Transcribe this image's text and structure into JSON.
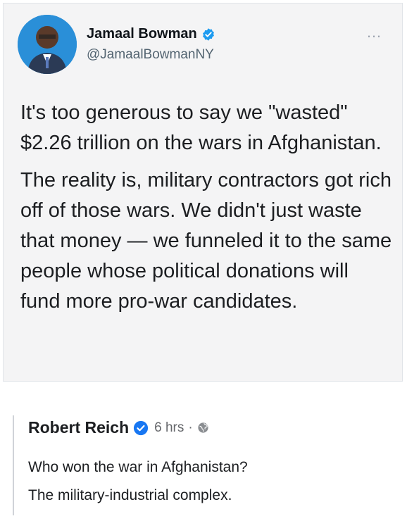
{
  "tweet": {
    "author_name": "Jamaal Bowman",
    "author_handle": "@JamaalBowmanNY",
    "more_icon": "…",
    "paragraphs": [
      "It's too generous to say we \"wasted\" $2.26 trillion on the wars in Afghanistan.",
      "The reality is, military contractors got rich off of those wars. We didn't just waste that money — we funneled it to the same people whose political donations will fund more pro-war candidates."
    ]
  },
  "reply": {
    "author_name": "Robert Reich",
    "time": "6 hrs",
    "separator": "·",
    "lines": [
      "Who won the war in Afghanistan?",
      "The military-industrial complex."
    ]
  },
  "colors": {
    "verified_blue": "#1d9bf0",
    "facebook_verified_blue": "#1877f2",
    "card_background": "#f4f4f5"
  }
}
